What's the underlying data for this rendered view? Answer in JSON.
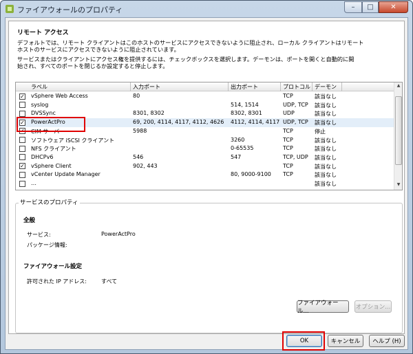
{
  "window": {
    "title": "ファイアウォールのプロパティ",
    "controls": [
      "–",
      "□",
      "✕"
    ]
  },
  "section": {
    "title": "リモート アクセス",
    "desc1": "デフォルトでは、リモート クライアントはこのホストのサービスにアクセスできないように阻止され、ローカル クライアントはリモート\nホストのサービスにアクセスできないように阻止されています。",
    "desc2": "サービスまたはクライアントにアクセス権を提供するには、チェックボックスを選択します。デーモンは、ポートを開くと自動的に開\n始され、すべてのポートを閉じるか設定すると停止します。"
  },
  "table": {
    "columns": [
      "ラベル",
      "入力ポート",
      "出力ポート",
      "プロトコル",
      "デーモン"
    ],
    "rows": [
      {
        "checked": true,
        "label": "vSphere Web Access",
        "in": "80",
        "out": "",
        "proto": "TCP",
        "daemon": "該当なし"
      },
      {
        "checked": false,
        "label": "syslog",
        "in": "",
        "out": "514, 1514",
        "proto": "UDP, TCP",
        "daemon": "該当なし"
      },
      {
        "checked": false,
        "label": "DVSSync",
        "in": "8301, 8302",
        "out": "8302, 8301",
        "proto": "UDP",
        "daemon": "該当なし"
      },
      {
        "checked": true,
        "label": "PowerActPro",
        "in": "69, 200, 4114, 4117, 4112, 4626",
        "out": "4112, 4114, 4117",
        "proto": "UDP, TCP",
        "daemon": "該当なし"
      },
      {
        "checked": true,
        "label": "CIM サーバ",
        "in": "5988",
        "out": "",
        "proto": "TCP",
        "daemon": "停止"
      },
      {
        "checked": false,
        "label": "ソフトウェア iSCSI クライアント",
        "in": "",
        "out": "3260",
        "proto": "TCP",
        "daemon": "該当なし"
      },
      {
        "checked": false,
        "label": "NFS クライアント",
        "in": "",
        "out": "0-65535",
        "proto": "TCP",
        "daemon": "該当なし"
      },
      {
        "checked": false,
        "label": "DHCPv6",
        "in": "546",
        "out": "547",
        "proto": "TCP, UDP",
        "daemon": "該当なし"
      },
      {
        "checked": true,
        "label": "vSphere Client",
        "in": "902, 443",
        "out": "",
        "proto": "TCP",
        "daemon": "該当なし"
      },
      {
        "checked": false,
        "label": "vCenter Update Manager",
        "in": "",
        "out": "80, 9000-9100",
        "proto": "TCP",
        "daemon": "該当なし"
      },
      {
        "checked": false,
        "label": "…",
        "in": "",
        "out": "",
        "proto": "",
        "daemon": "該当なし"
      }
    ]
  },
  "props": {
    "legend": "サービスのプロパティ",
    "general": "全般",
    "service_label": "サービス:",
    "service_value": "PowerActPro",
    "package_label": "パッケージ情報:",
    "fw_title": "ファイアウォール設定",
    "ip_label": "許可された IP アドレス:",
    "ip_value": "すべて",
    "firewall_btn": "ファイアウォール...",
    "options_btn": "オプション..."
  },
  "footer": {
    "ok": "OK",
    "cancel": "キャンセル",
    "help": "ヘルプ (H)"
  },
  "colors": {
    "highlight": "#e00000",
    "selected_row": "#e3eef9"
  }
}
